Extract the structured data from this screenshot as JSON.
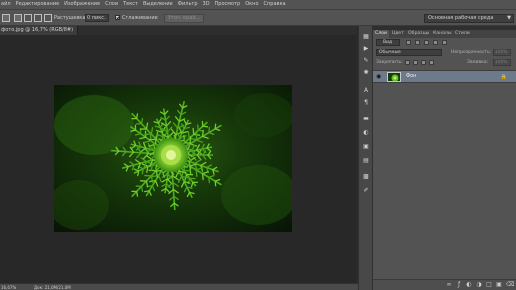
{
  "menu": [
    "айл",
    "Редактирование",
    "Изображение",
    "Слои",
    "Текст",
    "Выделение",
    "Фильтр",
    "3D",
    "Просмотр",
    "Окно",
    "Справка"
  ],
  "options": {
    "feather_label": "Растушевка:",
    "feather_value": "0 пикс.",
    "antialias_label": "Сглаживание",
    "refine_edge": "Уточ. край...",
    "workspace": "Основная рабочая среда"
  },
  "document": {
    "tab": "фото.jpg @ 16,7% (RGB/8#)"
  },
  "status": {
    "zoom": "16,67%",
    "doc": "Док: 21,0M/21,0M"
  },
  "panel": {
    "tabs": [
      "Слои",
      "Цвет",
      "Образцы",
      "Каналы",
      "Стили"
    ],
    "kind": "Вид",
    "blend_mode": "Обычные",
    "opacity_label": "Непрозрачность:",
    "opacity_value": "100%",
    "lock_label": "Закрепить:",
    "fill_label": "Заливка:",
    "fill_value": "100%",
    "layer_name": "Фон"
  },
  "colors": {
    "chrome": "#535353",
    "canvas_bg": "#282828",
    "selected_layer": "#6d7a8a",
    "foliage": "#3fae1d"
  }
}
